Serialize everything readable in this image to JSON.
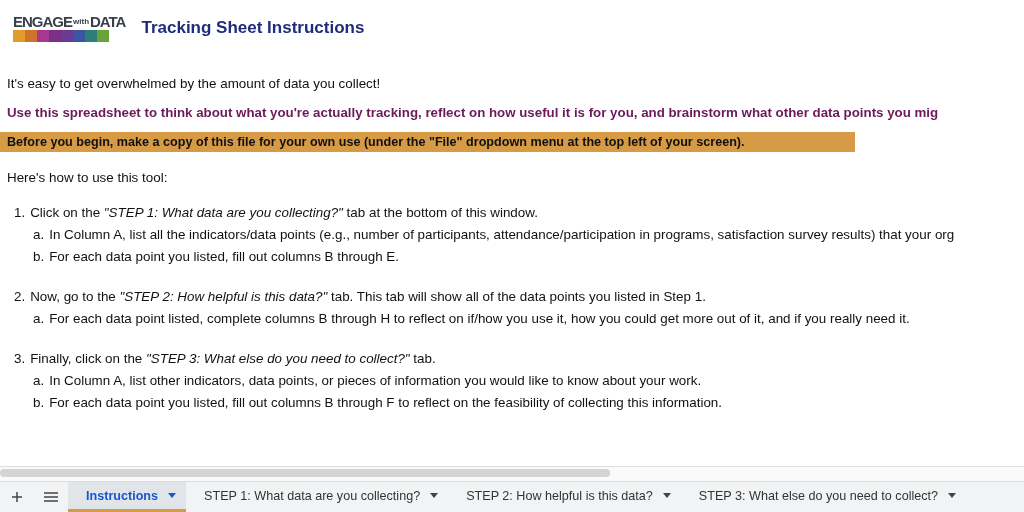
{
  "logo": {
    "words": [
      "ENGAGE",
      "with",
      "DATA"
    ]
  },
  "title": "Tracking Sheet Instructions",
  "intro": "It's easy to get overwhelmed by the amount of data you collect!",
  "purpose": "Use this spreadsheet to think about what you're actually tracking, reflect on how useful it is for you, and brainstorm what other data points you mig",
  "notice": "Before you begin, make a copy of this file for your own use (under the \"File\" dropdown menu at the top left of your screen).",
  "howto": "Here's how to use this tool:",
  "steps": [
    {
      "number": "1.",
      "text": "Click on the *\"STEP 1: What data are you collecting?\"* tab at the bottom of this window.",
      "substeps": [
        {
          "letter": "a.",
          "text": "In Column A, list all the indicators/data points (e.g., number of participants, attendance/participation in programs, satisfaction survey results) that your org"
        },
        {
          "letter": "b.",
          "text": "For each data point you listed, fill out columns B through E."
        }
      ]
    },
    {
      "number": "2.",
      "text": "Now, go to the *\"STEP 2: How helpful is this data?\"* tab. This tab will show all of the data points you listed in Step 1.",
      "substeps": [
        {
          "letter": "a.",
          "text": "For each data point listed, complete columns B through H to reflect on if/how you use it, how you could get more out of it, and if you really need it."
        }
      ]
    },
    {
      "number": "3.",
      "text": "Finally, click on the *\"STEP 3: What else do you need to collect?\"* tab.",
      "substeps": [
        {
          "letter": "a.",
          "text": "In Column A, list other indicators, data points, or pieces of information you would like to know about your work."
        },
        {
          "letter": "b.",
          "text": "For each data point you listed, fill out columns B through F to reflect on the feasibility of collecting this information."
        }
      ]
    }
  ],
  "sheet_tabs": [
    {
      "label": "Instructions",
      "selected": true
    },
    {
      "label": "STEP 1: What data are you collecting?",
      "selected": false
    },
    {
      "label": "STEP 2: How helpful is this data?",
      "selected": false
    },
    {
      "label": "STEP 3: What else do you need to collect?",
      "selected": false
    }
  ]
}
